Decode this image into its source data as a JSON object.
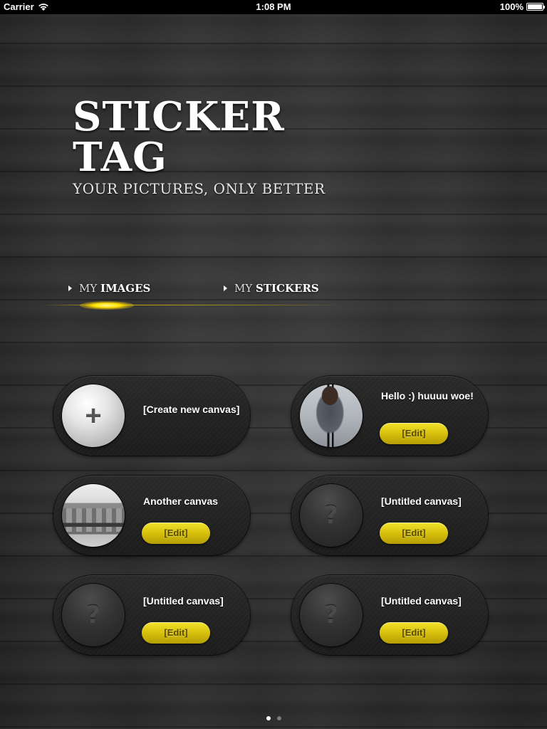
{
  "status_bar": {
    "carrier": "Carrier",
    "time": "1:08 PM",
    "battery": "100%"
  },
  "header": {
    "title_line1": "STICKER",
    "title_line2": "TAG",
    "subtitle": "YOUR PICTURES, ONLY BETTER"
  },
  "tabs": [
    {
      "prefix": "MY",
      "label": "IMAGES",
      "selected": true
    },
    {
      "prefix": "MY",
      "label": "STICKERS",
      "selected": false
    }
  ],
  "canvases": [
    {
      "label": "[Create new canvas]",
      "thumb": "add-icon"
    },
    {
      "label": "Hello :) huuuu woe!",
      "thumb": "photo-person",
      "edit_label": "[Edit]"
    },
    {
      "label": "Another canvas",
      "thumb": "photo-building",
      "edit_label": "[Edit]"
    },
    {
      "label": "[Untitled canvas]",
      "thumb": "question-icon",
      "edit_label": "[Edit]"
    },
    {
      "label": "[Untitled canvas]",
      "thumb": "question-icon",
      "edit_label": "[Edit]"
    },
    {
      "label": "[Untitled canvas]",
      "thumb": "question-icon",
      "edit_label": "[Edit]"
    }
  ],
  "pager": {
    "pages": 2,
    "current": 1
  },
  "icons": {
    "plus": "+",
    "question": "?"
  },
  "colors": {
    "accent": "#e8d21a",
    "background": "#2e2e2e"
  }
}
